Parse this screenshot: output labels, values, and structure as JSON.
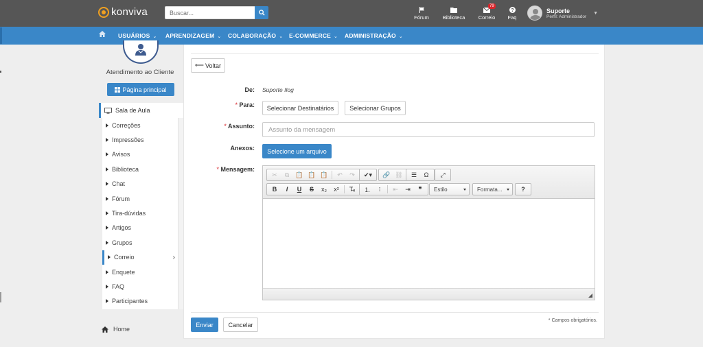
{
  "topbar": {
    "logo_text": "konviva",
    "search_placeholder": "Buscar...",
    "nav": [
      {
        "label": "Fórum",
        "icon": "flag-icon"
      },
      {
        "label": "Biblioteca",
        "icon": "folder-icon"
      },
      {
        "label": "Correio",
        "icon": "envelope-icon",
        "badge": "79"
      },
      {
        "label": "Faq",
        "icon": "question-icon"
      }
    ],
    "user": {
      "name": "Suporte",
      "profile": "Perfil: Administrador"
    }
  },
  "menu": {
    "items": [
      "USUÁRIOS",
      "APRENDIZAGEM",
      "COLABORAÇÃO",
      "E-COMMERCE",
      "ADMINISTRAÇÃO"
    ]
  },
  "sidebar": {
    "title": "Atendimento ao Cliente",
    "home_button": "Página principal",
    "sala": "Sala de Aula",
    "items": [
      "Correções",
      "Impressões",
      "Avisos",
      "Biblioteca",
      "Chat",
      "Fórum",
      "Tira-dúvidas",
      "Artigos",
      "Grupos",
      "Correio",
      "Enquete",
      "FAQ",
      "Participantes"
    ],
    "active_item": "Correio",
    "footer_home": "Home"
  },
  "form": {
    "back_button": "Voltar",
    "de_label": "De:",
    "de_value": "Suporte Ilog",
    "para_label": "Para:",
    "select_recipients": "Selecionar Destinatários",
    "select_groups": "Selecionar Grupos",
    "assunto_label": "Assunto:",
    "assunto_placeholder": "Assunto da mensagem",
    "anexos_label": "Anexos:",
    "select_file": "Selecione um arquivo",
    "mensagem_label": "Mensagem:",
    "required_mark": "*",
    "editor": {
      "style_combo": "Estilo",
      "format_combo": "Formata..."
    },
    "send_button": "Enviar",
    "cancel_button": "Cancelar",
    "required_note": "* Campos obrigatórios."
  },
  "colors": {
    "accent": "#3a87c8",
    "topbar": "#565656",
    "badge": "#d9262c"
  }
}
